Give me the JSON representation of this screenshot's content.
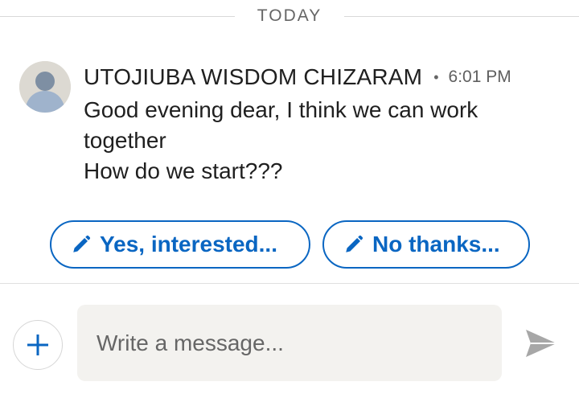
{
  "divider": {
    "label": "TODAY"
  },
  "message": {
    "sender": "UTOJIUBA WISDOM CHIZARAM",
    "separator": "•",
    "time": "6:01 PM",
    "lines": [
      "Good evening dear, I think we can work",
      "together",
      "How do we start???"
    ]
  },
  "quick_replies": [
    {
      "label": "Yes, interested...",
      "icon": "pencil-icon"
    },
    {
      "label": "No thanks...",
      "icon": "pencil-icon"
    }
  ],
  "composer": {
    "placeholder": "Write a message...",
    "add_icon": "plus-icon",
    "send_icon": "send-icon"
  },
  "colors": {
    "accent": "#0a66c2",
    "muted_text": "#666666",
    "input_bg": "#f3f2ef",
    "avatar_bg": "#dcd9d2",
    "avatar_figure": "#9fb3cc"
  }
}
